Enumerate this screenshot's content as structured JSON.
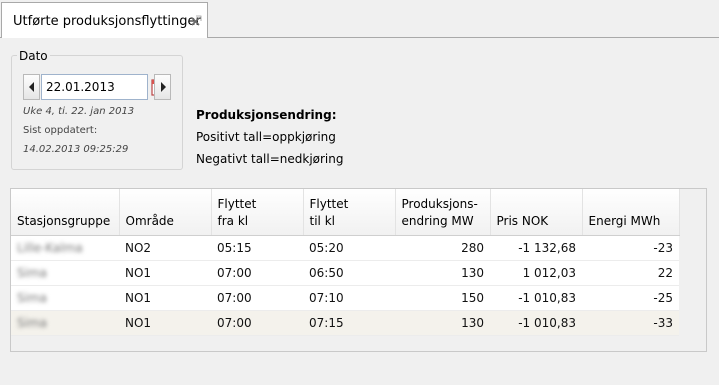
{
  "tab": {
    "label": "Utførte produksjonsflyttinger",
    "close_icon": "close-icon"
  },
  "date_group": {
    "legend": "Dato",
    "value": "22.01.2013",
    "week_info": "Uke 4, ti. 22. jan 2013",
    "updated_label": "Sist oppdatert:",
    "updated_value": "14.02.2013 09:25:29",
    "prev_icon": "arrow-left-icon",
    "next_icon": "arrow-right-icon",
    "calendar_icon": "calendar-icon"
  },
  "description": {
    "title": "Produksjonsendring:",
    "positive": "Positivt tall=oppkjøring",
    "negative": "Negativt tall=nedkjøring"
  },
  "table": {
    "headers": {
      "stasjonsgruppe": "Stasjonsgruppe",
      "omrade": "Område",
      "fra_1": "Flyttet",
      "fra_2": "fra kl",
      "til_1": "Flyttet",
      "til_2": "til kl",
      "endring_1": "Produksjons-",
      "endring_2": "endring MW",
      "pris": "Pris NOK",
      "energi": "Energi MWh"
    },
    "rows": [
      {
        "stasjon": "Lille-Kalma",
        "omrade": "NO2",
        "fra": "05:15",
        "til": "05:20",
        "endring": "280",
        "pris": "-1 132,68",
        "energi": "-23"
      },
      {
        "stasjon": "Sima",
        "omrade": "NO1",
        "fra": "07:00",
        "til": "06:50",
        "endring": "130",
        "pris": "1 012,03",
        "energi": "22"
      },
      {
        "stasjon": "Sima",
        "omrade": "NO1",
        "fra": "07:00",
        "til": "07:10",
        "endring": "150",
        "pris": "-1 010,83",
        "energi": "-25"
      },
      {
        "stasjon": "Sima",
        "omrade": "NO1",
        "fra": "07:00",
        "til": "07:15",
        "endring": "130",
        "pris": "-1 010,83",
        "energi": "-33"
      }
    ]
  }
}
